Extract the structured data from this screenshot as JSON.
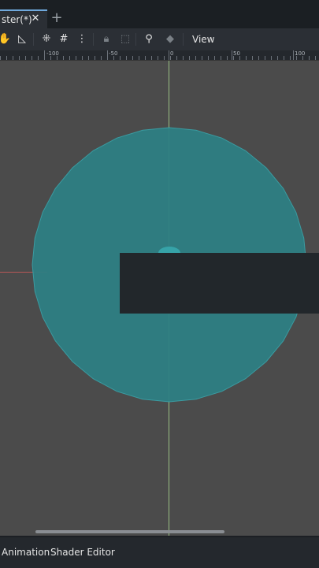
{
  "tabs": {
    "active_label": "ster(*)",
    "close_glyph": "✕",
    "add_glyph": "+"
  },
  "top_ghost_text": "",
  "toolbar": {
    "view_label": "View"
  },
  "ruler": {
    "labels": [
      "-100",
      "-50",
      "0",
      "50",
      "100"
    ]
  },
  "viewport": {
    "background": "#4b4b4b",
    "circle_color": "#2e7f83",
    "rect_color": "#22272b"
  },
  "bottom": {
    "animation_label": "Animation",
    "shader_label": "Shader Editor"
  }
}
